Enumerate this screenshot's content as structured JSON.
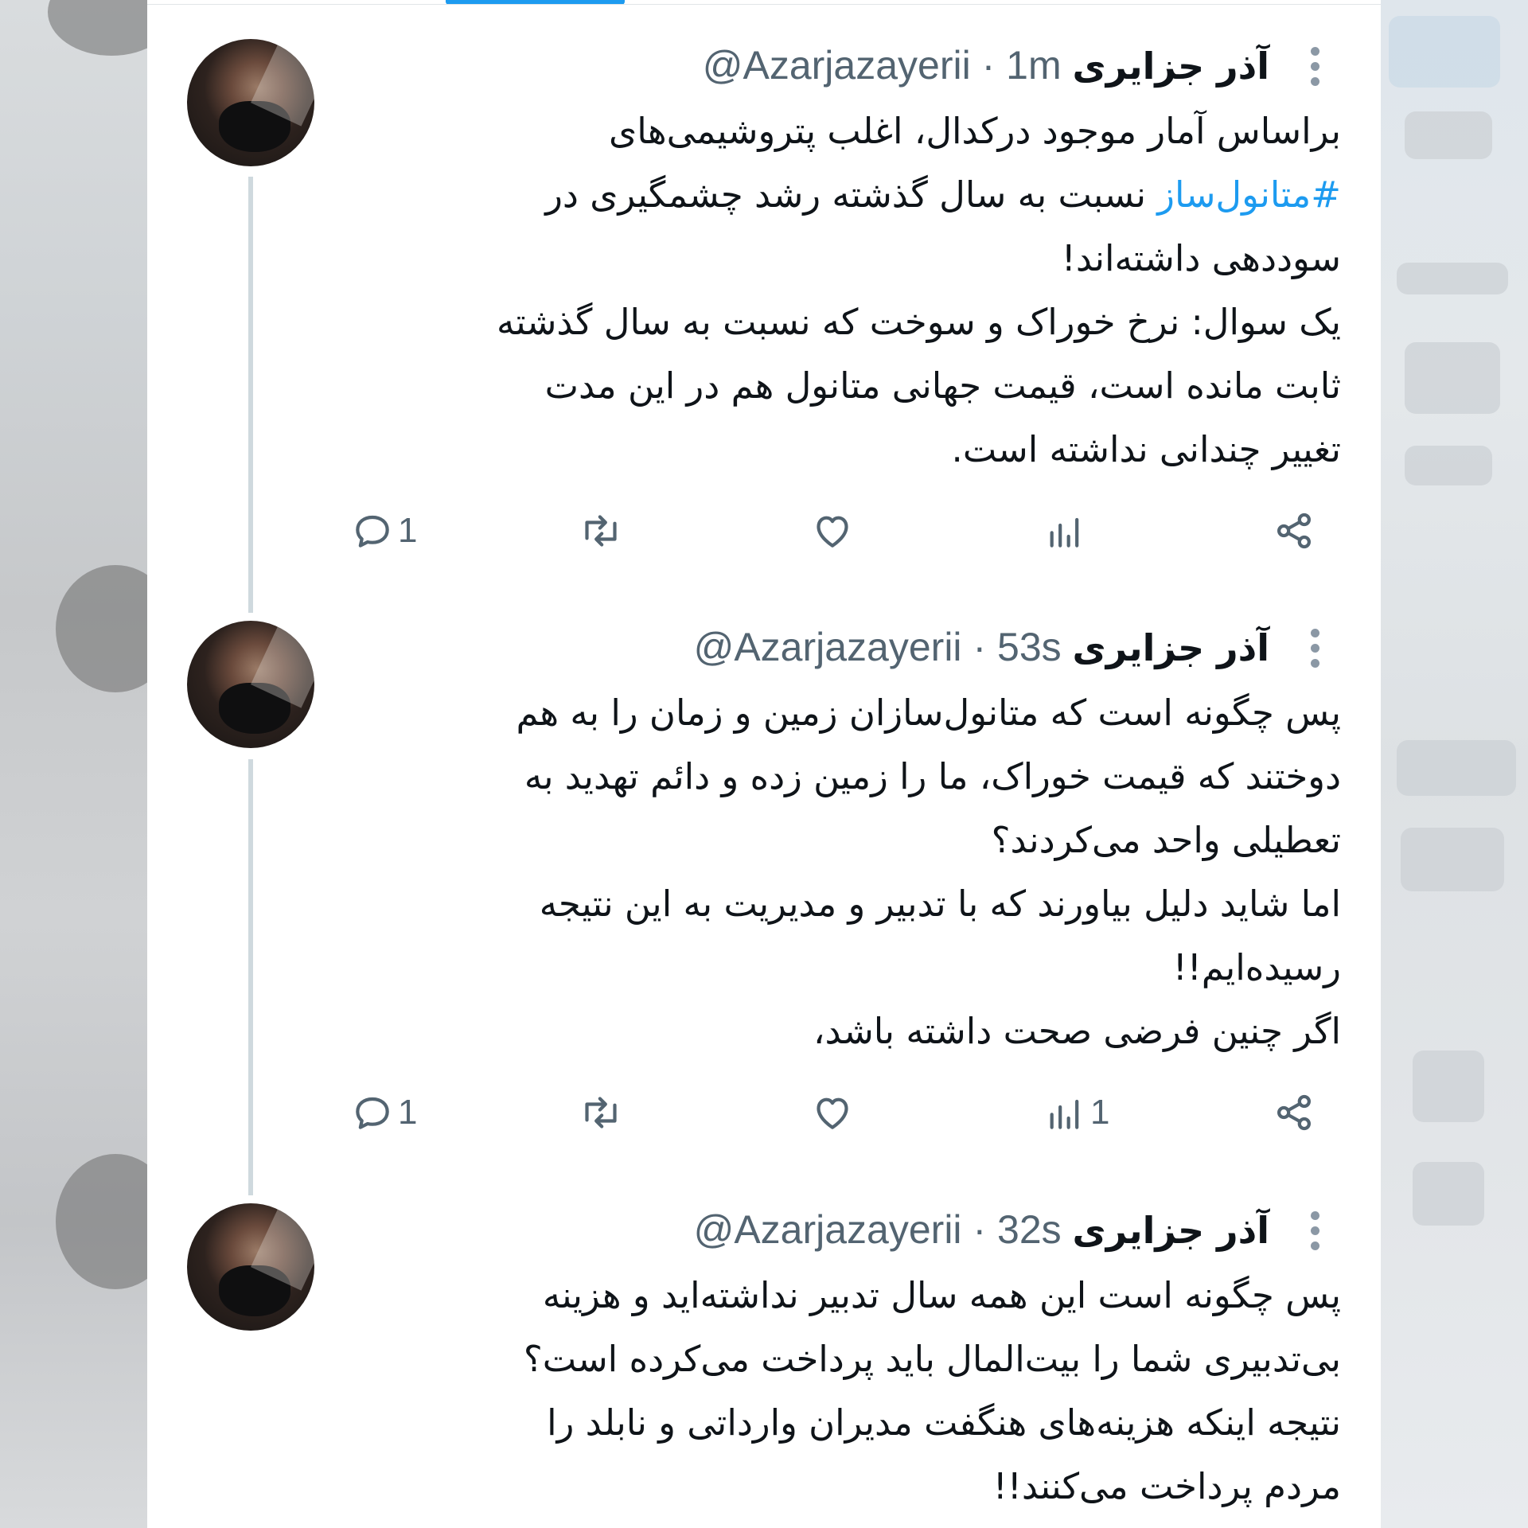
{
  "tweets": [
    {
      "name": "آذر جزایری",
      "handle": "@Azarjazayerii",
      "separator": "·",
      "time": "1m",
      "lines": [
        {
          "text": "براساس آمار موجود درکدال، اغلب پتروشیمی‌های"
        },
        {
          "hashtag": "#متانول‌ساز",
          "text": " نسبت به سال گذشته رشد چشمگیری در"
        },
        {
          "text": "سوددهی داشته‌اند!"
        },
        {
          "text": "یک سوال: نرخ خوراک و سوخت که نسبت به سال گذشته"
        },
        {
          "text": "ثابت مانده است، قیمت جهانی متانول هم در این مدت"
        },
        {
          "text": "تغییر چندانی نداشته است."
        }
      ],
      "reply_count": "1",
      "retweet_count": "",
      "views_count": ""
    },
    {
      "name": "آذر جزایری",
      "handle": "@Azarjazayerii",
      "separator": "·",
      "time": "53s",
      "lines": [
        {
          "text": "پس چگونه است که متانول‌سازان زمین و زمان را به هم"
        },
        {
          "text": "دوختند که قیمت خوراک، ما را زمین زده و دائم تهدید به"
        },
        {
          "text": "تعطیلی واحد می‌کردند؟"
        },
        {
          "text": "اما شاید دلیل بیاورند که با تدبیر و  مدیریت به این نتیجه"
        },
        {
          "text": "رسیده‌ایم!!"
        },
        {
          "text": "اگر چنین فرضی صحت داشته باشد،"
        }
      ],
      "reply_count": "1",
      "retweet_count": "",
      "views_count": "1"
    },
    {
      "name": "آذر جزایری",
      "handle": "@Azarjazayerii",
      "separator": "·",
      "time": "32s",
      "lines": [
        {
          "text": "پس چگونه است این همه سال تدبیر نداشته‌اید و هزینه"
        },
        {
          "text": "بی‌تدبیری شما را بیت‌المال باید پرداخت می‌کرده است؟"
        },
        {
          "text": "نتیجه اینکه هزینه‌های هنگفت  مدیران وارداتی و نابلد را"
        },
        {
          "text": "مردم پرداخت می‌کنند!!"
        }
      ]
    }
  ],
  "icons": {
    "reply": "reply-icon",
    "retweet": "retweet-icon",
    "like": "heart-icon",
    "views": "views-icon",
    "share": "share-icon",
    "more": "more-vertical-icon"
  },
  "colors": {
    "text": "#0f1419",
    "secondary": "#536471",
    "link": "#1d9bf0",
    "thread_line": "#cfd9de"
  }
}
